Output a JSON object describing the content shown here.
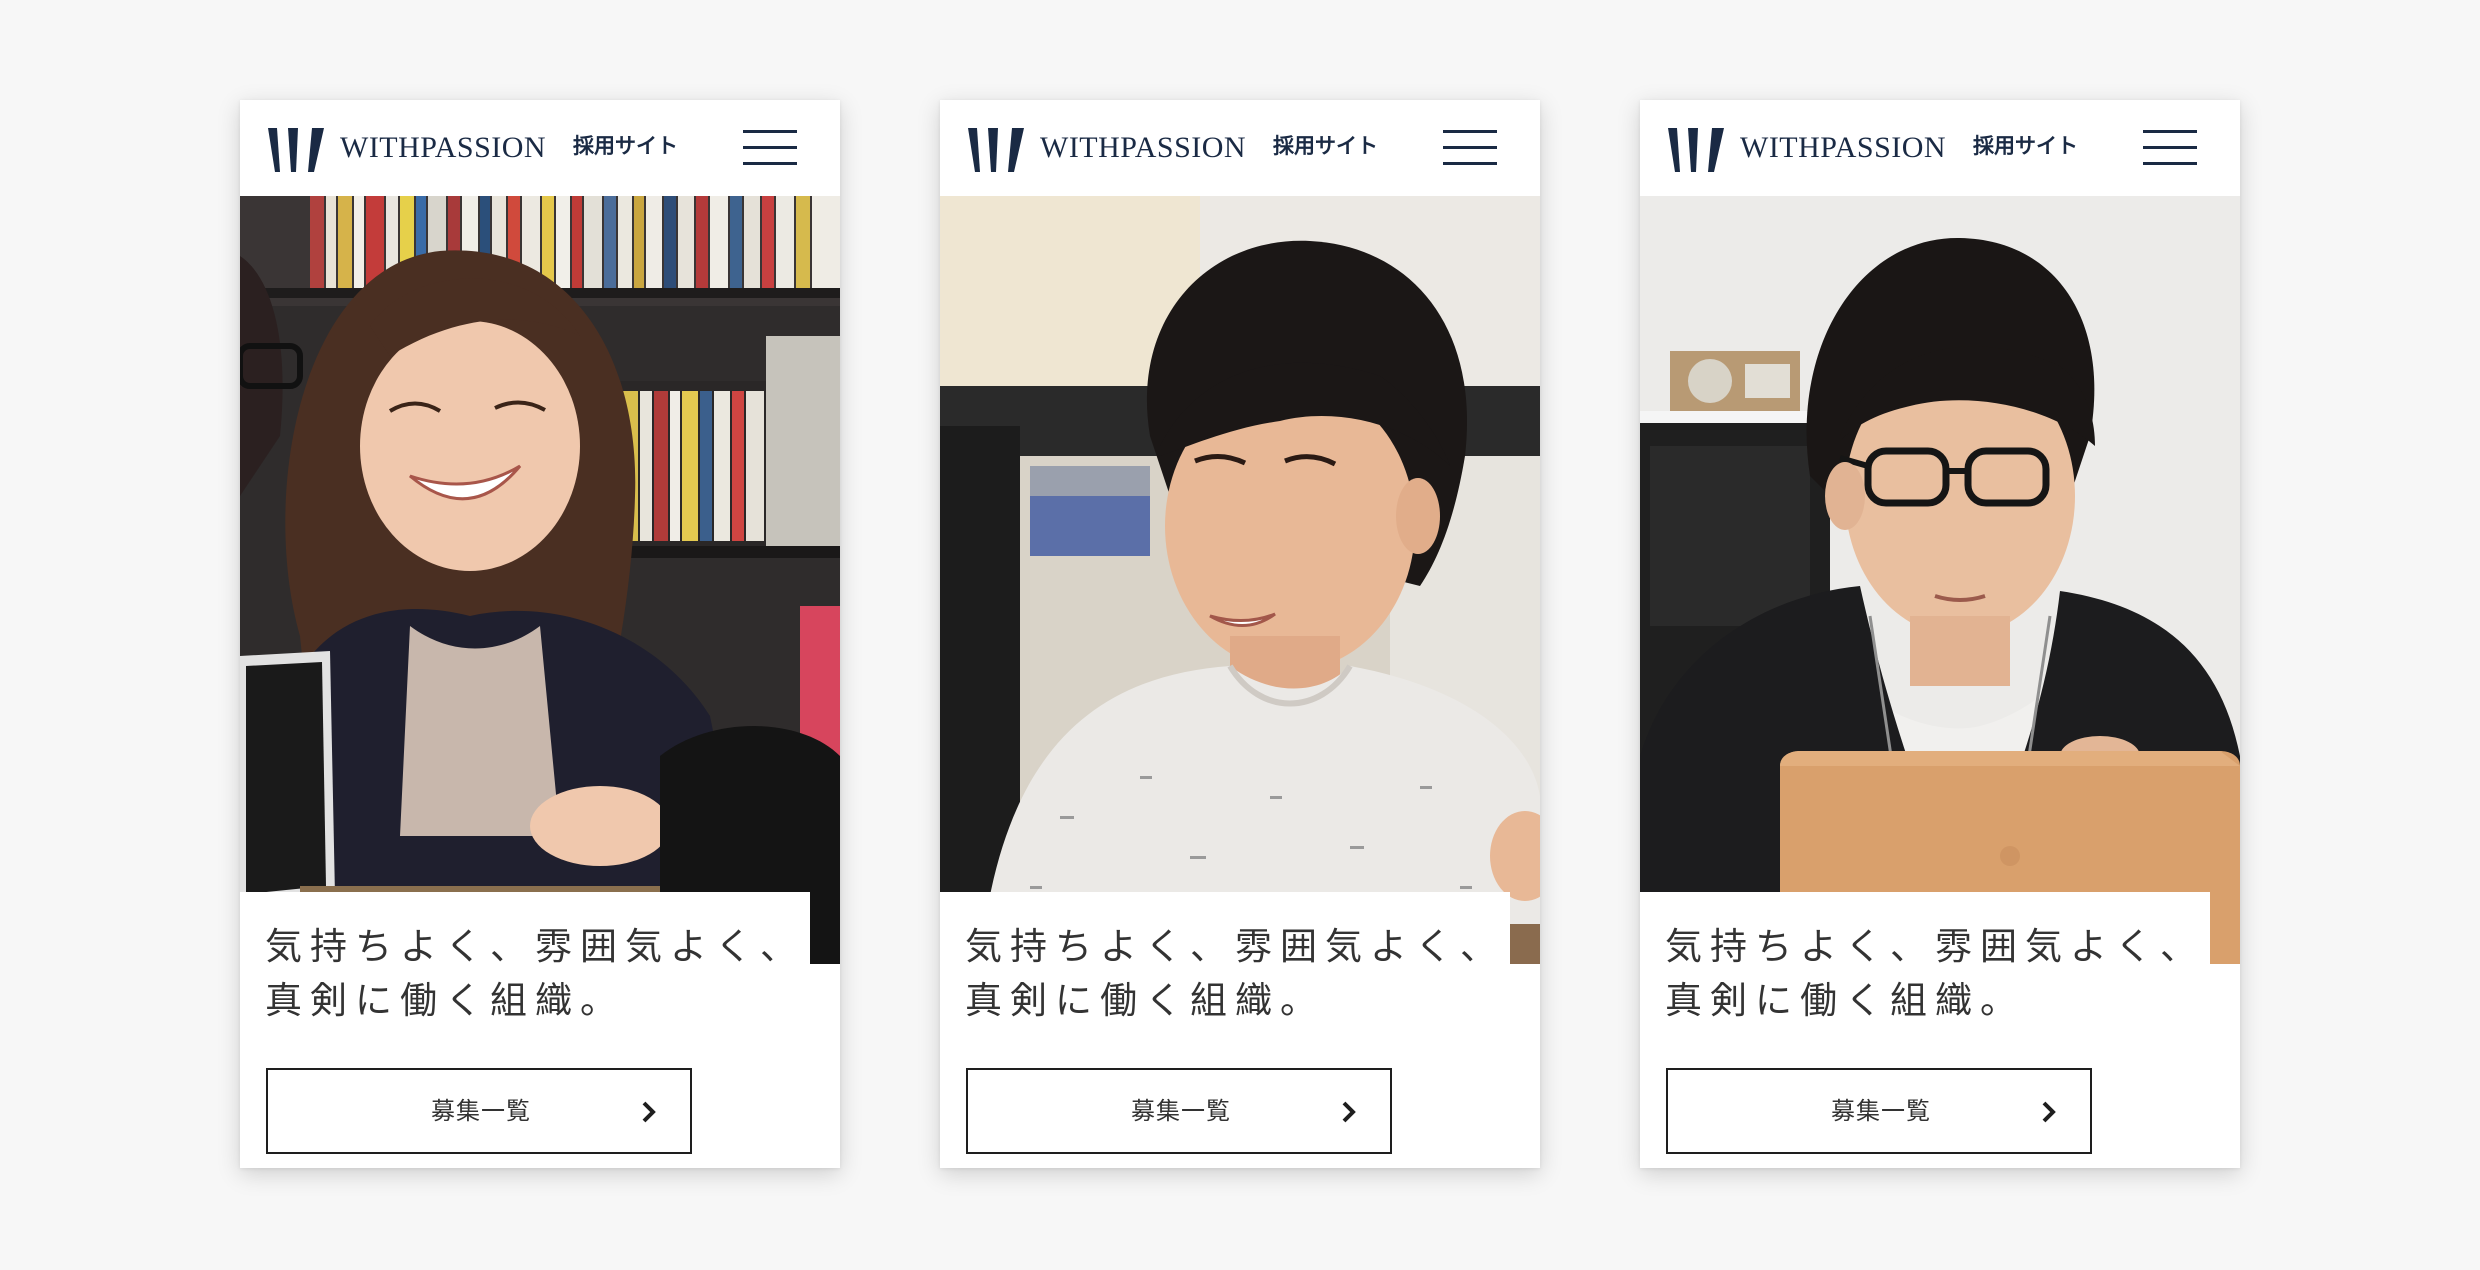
{
  "cards": [
    {
      "brand": "WITHPASSION",
      "subbrand": "採用サイト",
      "menu_icon": "hamburger-menu-icon",
      "catch": "気持ちよく、雰囲気よく、\n真剣に働く組織。",
      "cta_label": "募集一覧",
      "cta_icon": "chevron-right-icon"
    },
    {
      "brand": "WITHPASSION",
      "subbrand": "採用サイト",
      "menu_icon": "hamburger-menu-icon",
      "catch": "気持ちよく、雰囲気よく、\n真剣に働く組織。",
      "cta_label": "募集一覧",
      "cta_icon": "chevron-right-icon"
    },
    {
      "brand": "WITHPASSION",
      "subbrand": "採用サイト",
      "menu_icon": "hamburger-menu-icon",
      "catch": "気持ちよく、雰囲気よく、\n真剣に働く組織。",
      "cta_label": "募集一覧",
      "cta_icon": "chevron-right-icon"
    }
  ],
  "colors": {
    "page_background": "#f7f7f7",
    "brand_navy": "#1a2a44",
    "text": "#333333"
  }
}
